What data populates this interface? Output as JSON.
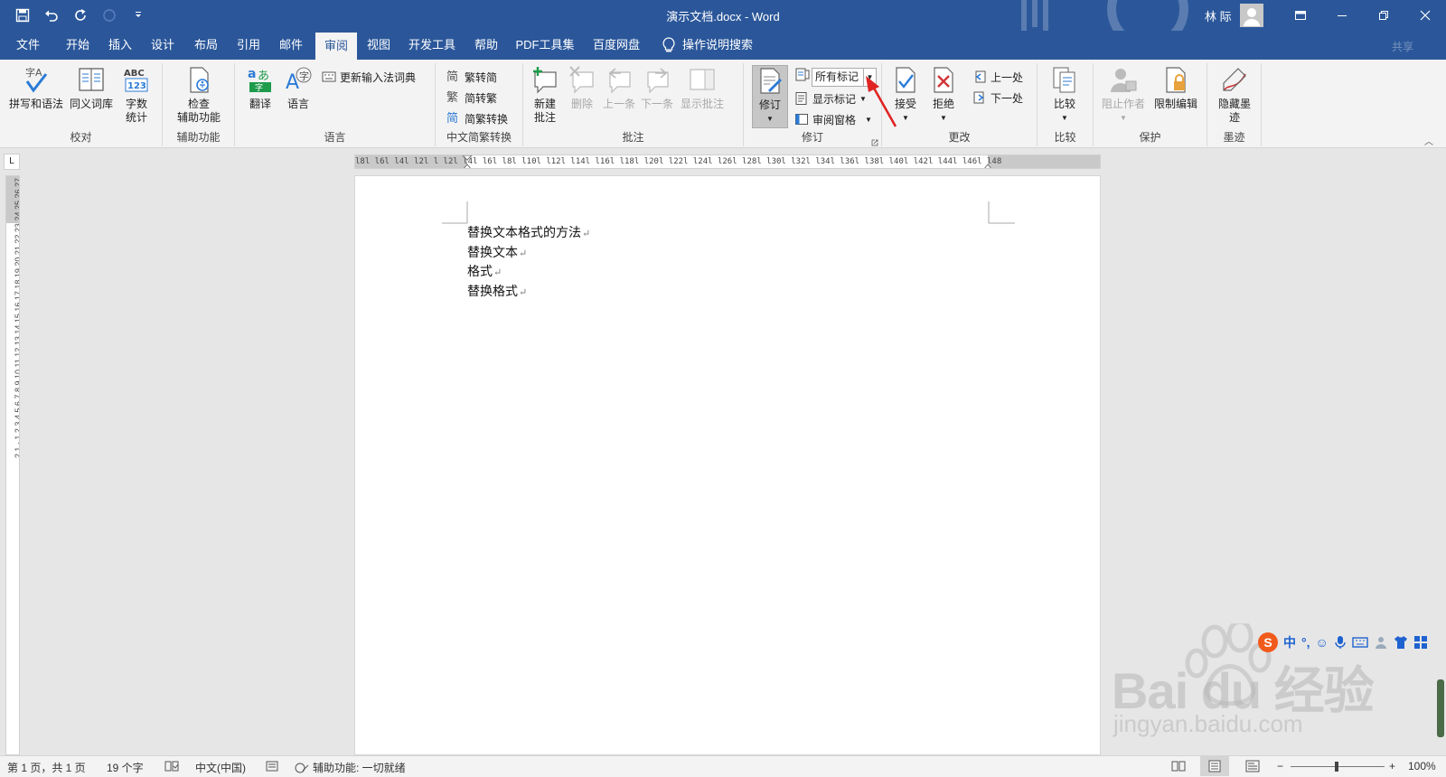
{
  "window": {
    "title": "演示文档.docx  -  Word",
    "user": "林 际",
    "accent": "#2b579a"
  },
  "tabs": [
    "文件",
    "开始",
    "插入",
    "设计",
    "布局",
    "引用",
    "邮件",
    "审阅",
    "视图",
    "开发工具",
    "帮助",
    "PDF工具集",
    "百度网盘"
  ],
  "active_tab": "审阅",
  "tell_me": "操作说明搜索",
  "share": "共享",
  "ribbon": {
    "proofing": {
      "label": "校对",
      "spelling": "拼写和语法",
      "thesaurus": "同义词库",
      "wordcount_l1": "字数",
      "wordcount_l2": "统计"
    },
    "accessibility": {
      "label": "辅助功能",
      "check_l1": "检查",
      "check_l2": "辅助功能"
    },
    "language": {
      "label": "语言",
      "translate": "翻译",
      "language": "语言",
      "ime_dict": "更新输入法词典"
    },
    "chinese": {
      "label": "中文简繁转换",
      "to_trad": "繁转简",
      "to_simp": "简转繁",
      "convert": "简繁转换"
    },
    "comments": {
      "label": "批注",
      "new_l1": "新建",
      "new_l2": "批注",
      "delete": "删除",
      "prev": "上一条",
      "next": "下一条",
      "show": "显示批注"
    },
    "tracking": {
      "label": "修订",
      "track": "修订",
      "markup_select": "所有标记",
      "show_markup": "显示标记",
      "review_pane": "审阅窗格"
    },
    "changes": {
      "label": "更改",
      "accept": "接受",
      "reject": "拒绝",
      "previous": "上一处",
      "next": "下一处"
    },
    "compare": {
      "label": "比较",
      "compare": "比较"
    },
    "protect": {
      "label": "保护",
      "block": "阻止作者",
      "restrict": "限制编辑"
    },
    "ink": {
      "label": "墨迹",
      "hide_l1": "隐藏墨",
      "hide_l2": "迹"
    }
  },
  "document": {
    "lines": [
      "替换文本格式的方法",
      "替换文本",
      "格式",
      "替换格式"
    ],
    "pilcrow": "↵"
  },
  "ruler": {
    "h_ticks": "l8l l6l l4l l2l  l  l2l l4l l6l l8l l10l l12l l14l l16l l18l l20l l22l l24l l26l l28l l30l l32l l34l l36l l38l  l40l l42l l44l l46l l48",
    "v_ticks": "2 1 · 1 2 3 4 5 6 7 8 9 10 11 12 13 14 15 16 17 18 19 20 21 22 23 24 25 26 27"
  },
  "ime": {
    "lang": "中",
    "punct": "°,"
  },
  "watermark": {
    "brand": "Bai du 经验",
    "url": "jingyan.baidu.com"
  },
  "status": {
    "page": "第 1 页，共 1 页",
    "words": "19 个字",
    "language": "中文(中国)",
    "accessibility": "辅助功能: 一切就绪",
    "zoom": "100%",
    "zoom_level": 1.0
  }
}
